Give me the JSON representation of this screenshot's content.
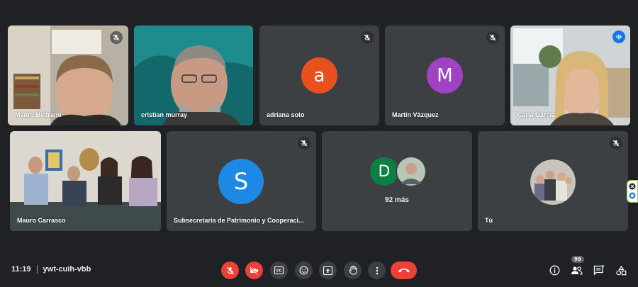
{
  "meeting": {
    "time": "11:19",
    "code": "ywt-cuih-vbb"
  },
  "participants": [
    {
      "name": "Mauro Beltrami",
      "muted": true
    },
    {
      "name": "cristian murray",
      "muted": false
    },
    {
      "name": "adriana soto",
      "initial": "a",
      "color": "#e8501e",
      "muted": true
    },
    {
      "name": "Martín Vázquez",
      "initial": "M",
      "color": "#a142c4",
      "muted": true
    },
    {
      "name": "Carla García",
      "speaking": true
    },
    {
      "name": "Mauro Carrasco"
    },
    {
      "name": "Subsecretaria de Patrimonio y Cooperaci...",
      "initial": "S",
      "color": "#1e88e5",
      "muted": true
    },
    {
      "name": "Tú",
      "muted": true
    }
  ],
  "overflow_tile": {
    "initial": "D",
    "color": "#0b8043",
    "more_label": "92 más"
  },
  "toolbar": {
    "people_count": "99"
  },
  "colors": {
    "background": "#202124",
    "tile": "#3c4043",
    "accent": "#8ab4f8",
    "danger": "#ea4335"
  }
}
